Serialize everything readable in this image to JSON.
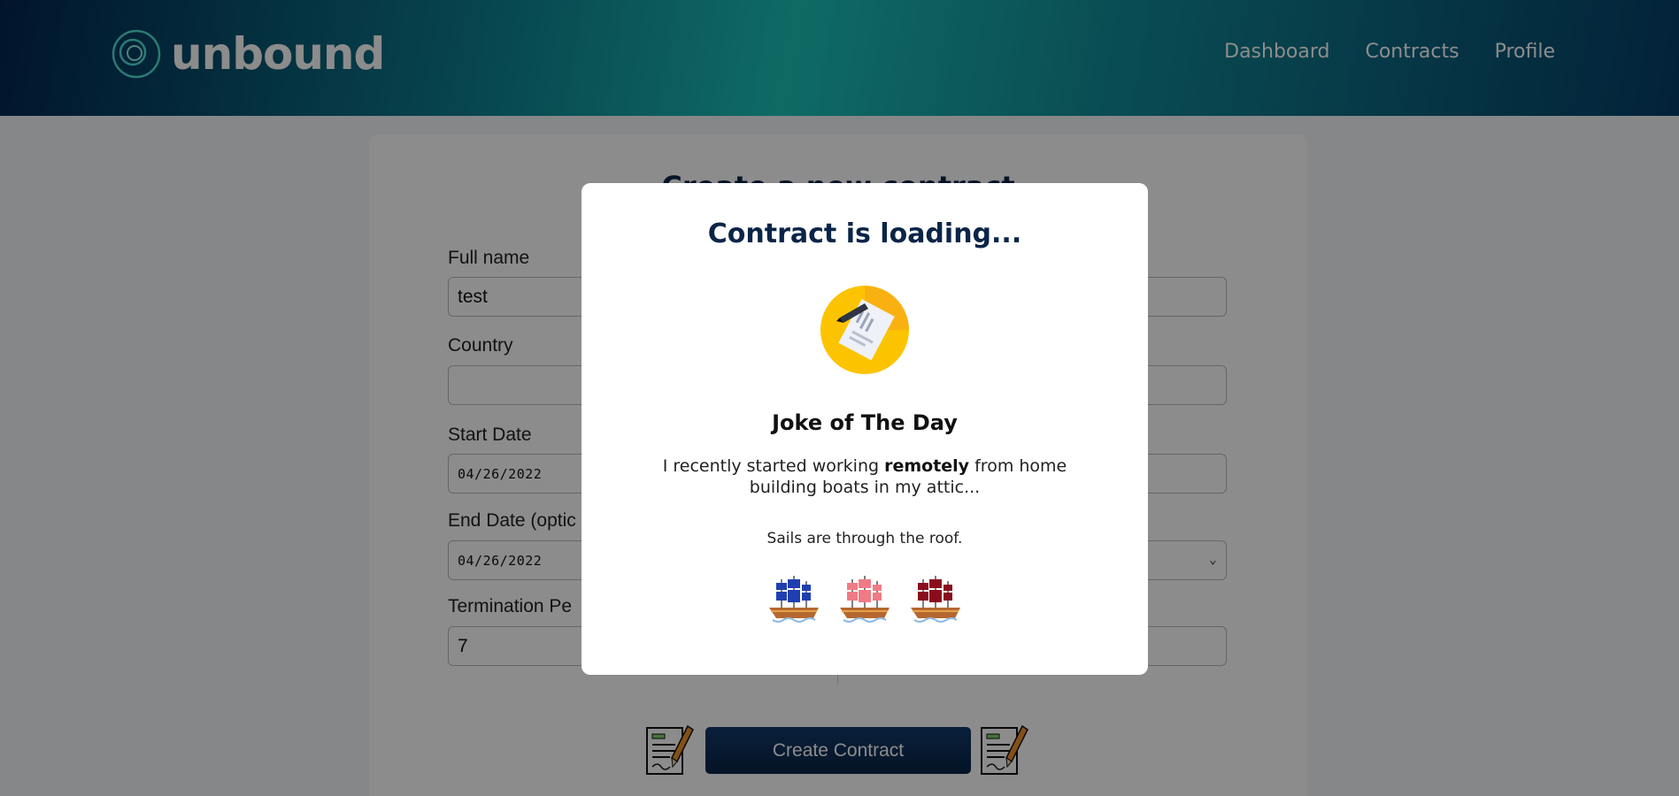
{
  "header": {
    "logo_text": "unbound",
    "nav": [
      "Dashboard",
      "Contracts",
      "Profile"
    ]
  },
  "form": {
    "title": "Create a new contract",
    "full_name_label": "Full name",
    "full_name_value": "test",
    "country_label": "Country",
    "country_value": "",
    "start_date_label": "Start Date",
    "start_date_value": "04/26/2022",
    "end_date_label": "End Date (optic",
    "end_date_value": "04/26/2022",
    "termination_label": "Termination Pe",
    "termination_value": "7",
    "create_button": "Create Contract"
  },
  "modal": {
    "title": "Contract is loading...",
    "joke_title": "Joke of The Day",
    "joke_setup_before": "I recently started working ",
    "joke_setup_bold": "remotely",
    "joke_setup_after": " from home building boats in my attic...",
    "joke_punchline": "Sails are through the roof.",
    "ship_colors": [
      "#1f3fb0",
      "#f07b85",
      "#8a0d1e"
    ]
  },
  "colors": {
    "brand_dark": "#0a2547",
    "brand_teal": "#1cc2b8"
  }
}
